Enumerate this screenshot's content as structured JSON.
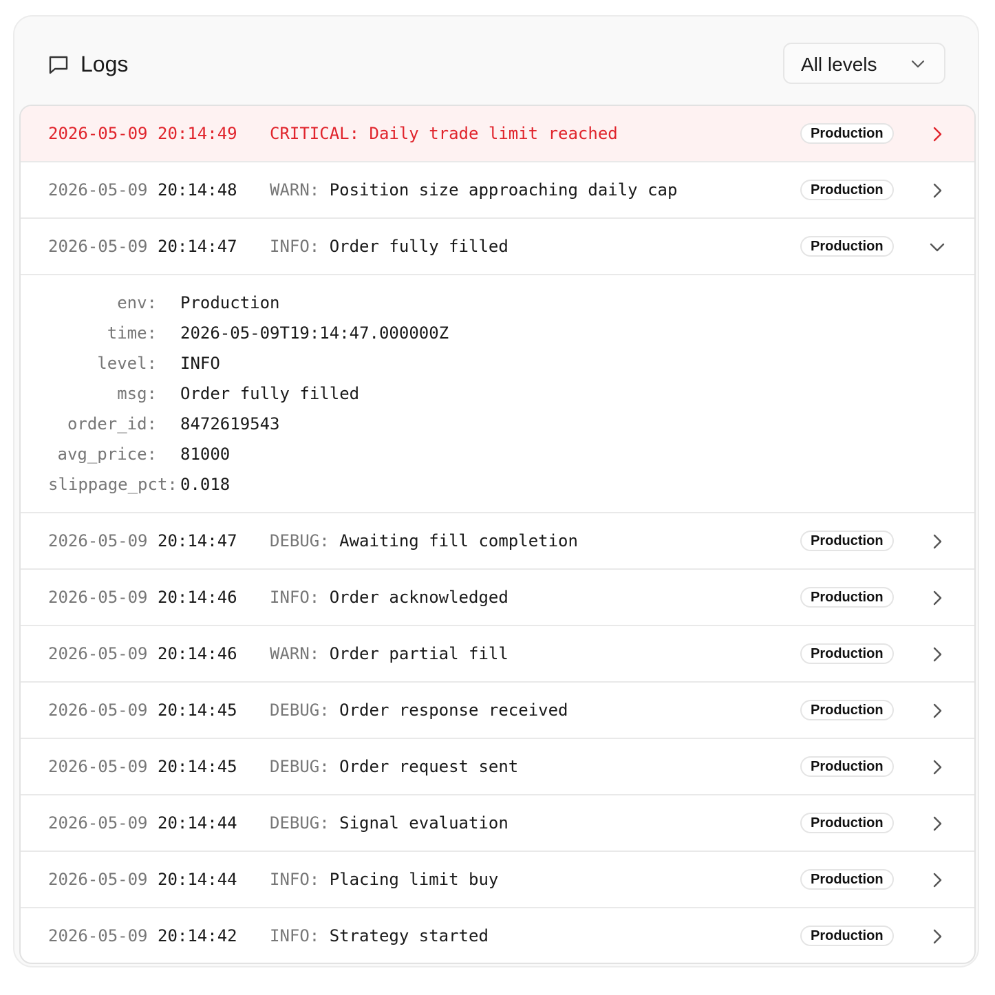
{
  "header": {
    "title": "Logs",
    "filter": "All levels"
  },
  "colors": {
    "critical": "#e0242c",
    "critical_bg": "#fef2f2",
    "muted": "#777777"
  },
  "logs": [
    {
      "date": "2026-05-09",
      "time": "20:14:49",
      "level": "CRITICAL:",
      "message": " Daily trade limit reached",
      "env": "Production",
      "critical": true,
      "expanded": false
    },
    {
      "date": "2026-05-09",
      "time": "20:14:48",
      "level": "WARN:",
      "message": " Position size approaching daily cap",
      "env": "Production",
      "critical": false,
      "expanded": false
    },
    {
      "date": "2026-05-09",
      "time": "20:14:47",
      "level": "INFO:",
      "message": " Order fully filled",
      "env": "Production",
      "critical": false,
      "expanded": true
    },
    {
      "date": "2026-05-09",
      "time": "20:14:47",
      "level": "DEBUG:",
      "message": " Awaiting fill completion",
      "env": "Production",
      "critical": false,
      "expanded": false
    },
    {
      "date": "2026-05-09",
      "time": "20:14:46",
      "level": "INFO:",
      "message": " Order acknowledged",
      "env": "Production",
      "critical": false,
      "expanded": false
    },
    {
      "date": "2026-05-09",
      "time": "20:14:46",
      "level": "WARN:",
      "message": " Order partial fill",
      "env": "Production",
      "critical": false,
      "expanded": false
    },
    {
      "date": "2026-05-09",
      "time": "20:14:45",
      "level": "DEBUG:",
      "message": " Order response received",
      "env": "Production",
      "critical": false,
      "expanded": false
    },
    {
      "date": "2026-05-09",
      "time": "20:14:45",
      "level": "DEBUG:",
      "message": " Order request sent",
      "env": "Production",
      "critical": false,
      "expanded": false
    },
    {
      "date": "2026-05-09",
      "time": "20:14:44",
      "level": "DEBUG:",
      "message": " Signal evaluation",
      "env": "Production",
      "critical": false,
      "expanded": false
    },
    {
      "date": "2026-05-09",
      "time": "20:14:44",
      "level": "INFO:",
      "message": " Placing limit buy",
      "env": "Production",
      "critical": false,
      "expanded": false
    },
    {
      "date": "2026-05-09",
      "time": "20:14:42",
      "level": "INFO:",
      "message": " Strategy started",
      "env": "Production",
      "critical": false,
      "expanded": false
    }
  ],
  "detail": [
    {
      "key": "env:",
      "value": "Production"
    },
    {
      "key": "time:",
      "value": "2026-05-09T19:14:47.000000Z"
    },
    {
      "key": "level:",
      "value": "INFO"
    },
    {
      "key": "msg:",
      "value": "Order fully filled"
    },
    {
      "key": "order_id:",
      "value": "8472619543"
    },
    {
      "key": "avg_price:",
      "value": "81000"
    },
    {
      "key": "slippage_pct:",
      "value": "0.018"
    }
  ]
}
